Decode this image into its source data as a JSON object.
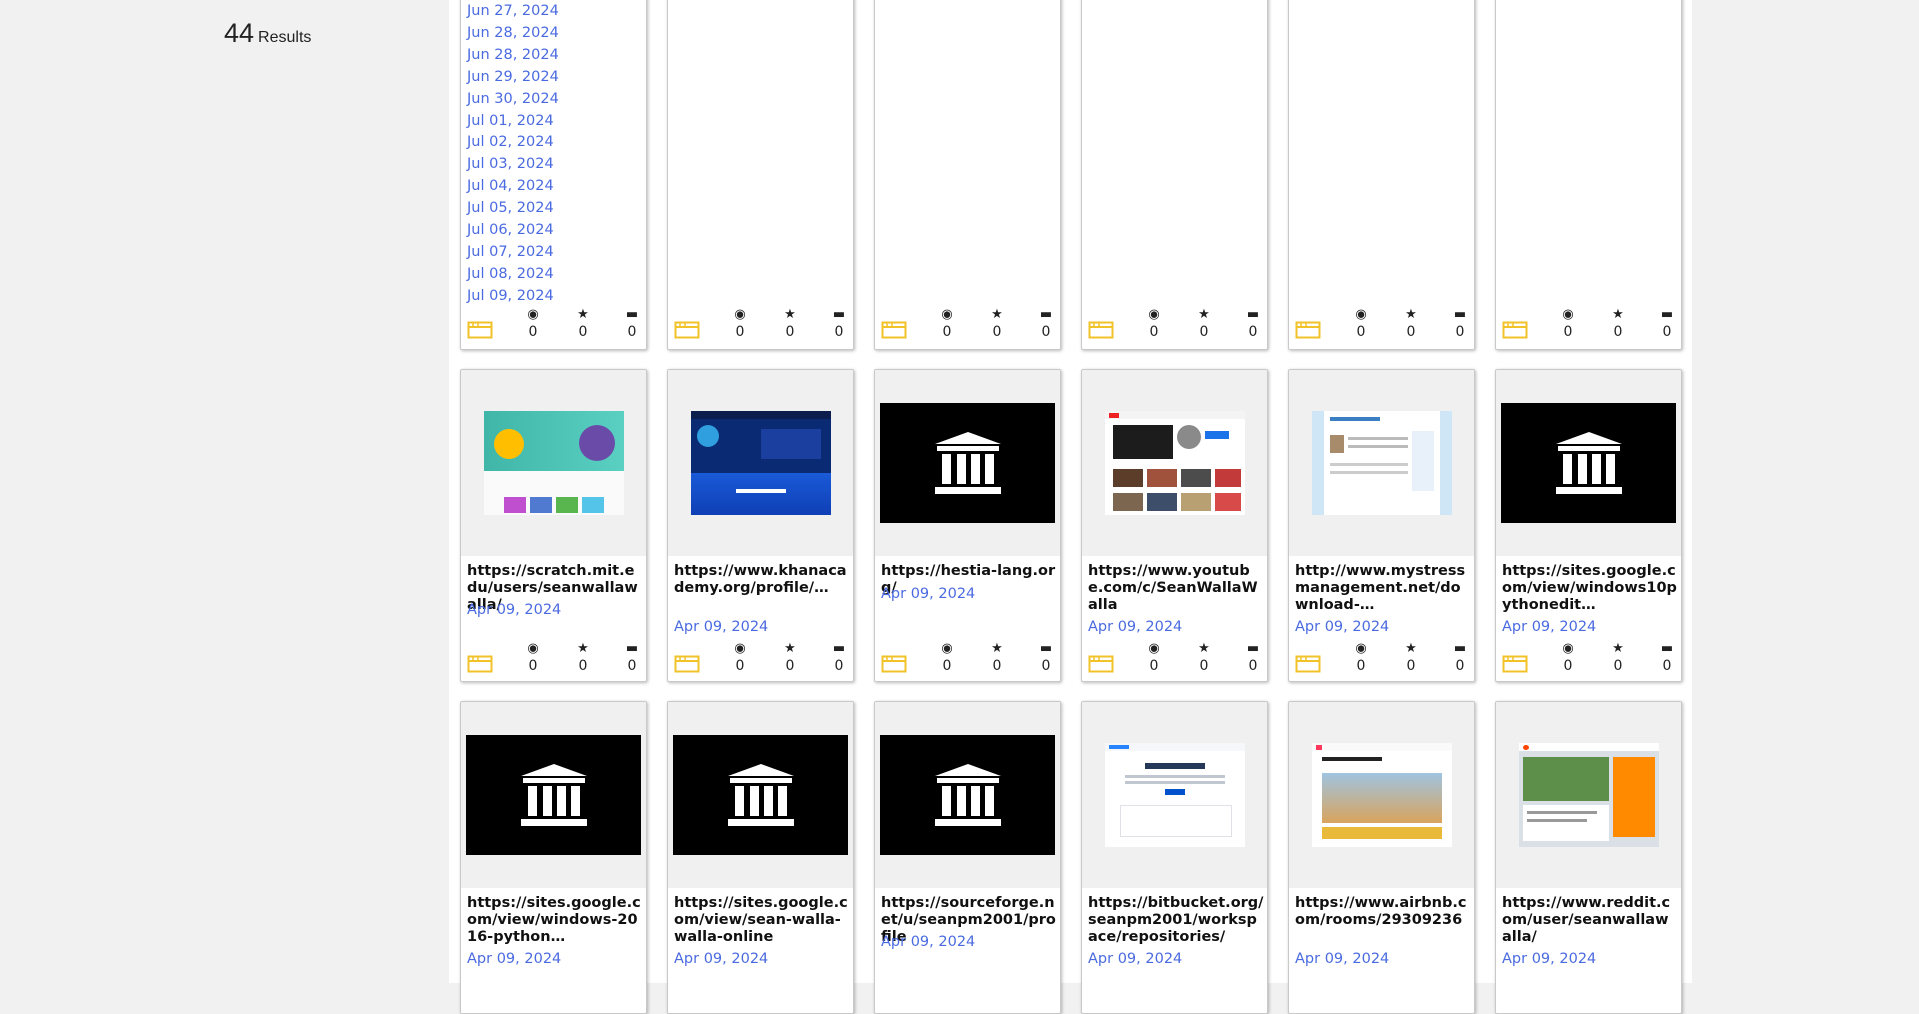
{
  "results": {
    "count": "44",
    "label": "Results"
  },
  "top_card": {
    "dates": [
      "Jun 27, 2024",
      "Jun 28, 2024",
      "Jun 28, 2024",
      "Jun 29, 2024",
      "Jun 30, 2024",
      "Jul 01, 2024",
      "Jul 02, 2024",
      "Jul 03, 2024",
      "Jul 04, 2024",
      "Jul 05, 2024",
      "Jul 06, 2024",
      "Jul 07, 2024",
      "Jul 08, 2024",
      "Jul 09, 2024"
    ]
  },
  "stats": {
    "views": "0",
    "favorites": "0",
    "comments": "0"
  },
  "row1_stats": [
    {
      "views": "0",
      "favorites": "0",
      "comments": "0"
    },
    {
      "views": "0",
      "favorites": "0",
      "comments": "0"
    },
    {
      "views": "0",
      "favorites": "0",
      "comments": "0"
    },
    {
      "views": "0",
      "favorites": "0",
      "comments": "0"
    },
    {
      "views": "0",
      "favorites": "0",
      "comments": "0"
    },
    {
      "views": "0",
      "favorites": "0",
      "comments": "0"
    }
  ],
  "row2": [
    {
      "title": "https://scratch.mit.edu/users/seanwallawalla/",
      "date": "Apr 09, 2024",
      "thumb": "scratch-screenshot",
      "views": "0",
      "favorites": "0",
      "comments": "0"
    },
    {
      "title": "https://www.khanacademy.org/profile/…",
      "date": "Apr 09, 2024",
      "thumb": "khanacademy-screenshot",
      "views": "0",
      "favorites": "0",
      "comments": "0"
    },
    {
      "title": "https://hestia-lang.org/",
      "date": "Apr 09, 2024",
      "thumb": "archive-logo",
      "views": "0",
      "favorites": "0",
      "comments": "0"
    },
    {
      "title": "https://www.youtube.com/c/SeanWallaWalla",
      "date": "Apr 09, 2024",
      "thumb": "youtube-screenshot",
      "views": "0",
      "favorites": "0",
      "comments": "0"
    },
    {
      "title": "http://www.mystressmanagement.net/download-…",
      "date": "Apr 09, 2024",
      "thumb": "mystress-screenshot",
      "views": "0",
      "favorites": "0",
      "comments": "0"
    },
    {
      "title": "https://sites.google.com/view/windows10pythonedit…",
      "date": "Apr 09, 2024",
      "thumb": "archive-logo",
      "views": "0",
      "favorites": "0",
      "comments": "0"
    }
  ],
  "row3": [
    {
      "title": "https://sites.google.com/view/windows-2016-python…",
      "date": "Apr 09, 2024",
      "thumb": "archive-logo"
    },
    {
      "title": "https://sites.google.com/view/sean-walla-walla-online",
      "date": "Apr 09, 2024",
      "thumb": "archive-logo"
    },
    {
      "title": "https://sourceforge.net/u/seanpm2001/profile",
      "date": "Apr 09, 2024",
      "thumb": "archive-logo"
    },
    {
      "title": "https://bitbucket.org/seanpm2001/workspace/repositories/",
      "date": "Apr 09, 2024",
      "thumb": "bitbucket-screenshot"
    },
    {
      "title": "https://www.airbnb.com/rooms/29309236",
      "date": "Apr 09, 2024",
      "thumb": "airbnb-screenshot"
    },
    {
      "title": "https://www.reddit.com/user/seanwallawalla/",
      "date": "Apr 09, 2024",
      "thumb": "reddit-screenshot"
    }
  ],
  "colors": {
    "link": "#4a6ae0",
    "media_icon": "#f2c229",
    "panel_bg": "#f1f1f1"
  }
}
